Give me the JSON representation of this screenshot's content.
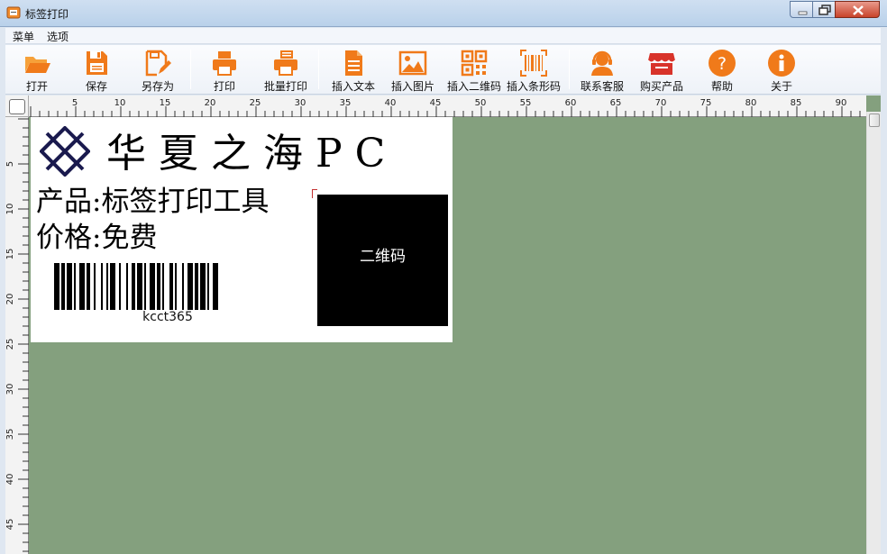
{
  "window": {
    "title": "标签打印"
  },
  "menu": {
    "items": [
      "菜单",
      "选项"
    ]
  },
  "toolbar": {
    "buttons": [
      {
        "label": "打开",
        "icon": "folder-open-icon"
      },
      {
        "label": "保存",
        "icon": "save-icon"
      },
      {
        "label": "另存为",
        "icon": "save-as-icon"
      },
      {
        "label": "打印",
        "icon": "printer-icon"
      },
      {
        "label": "批量打印",
        "icon": "batch-print-icon"
      },
      {
        "label": "插入文本",
        "icon": "text-document-icon"
      },
      {
        "label": "插入图片",
        "icon": "image-icon"
      },
      {
        "label": "插入二维码",
        "icon": "qr-code-icon"
      },
      {
        "label": "插入条形码",
        "icon": "barcode-icon"
      },
      {
        "label": "联系客服",
        "icon": "customer-service-icon"
      },
      {
        "label": "购买产品",
        "icon": "shop-icon"
      },
      {
        "label": "帮助",
        "icon": "help-icon"
      },
      {
        "label": "关于",
        "icon": "info-icon"
      }
    ],
    "accent_color": "#f07a1a",
    "shop_color": "#d8332a"
  },
  "rulers": {
    "horizontal": [
      "5",
      "10",
      "15",
      "20",
      "25",
      "30",
      "35",
      "40",
      "45",
      "50",
      "55",
      "60",
      "65",
      "70",
      "75",
      "80",
      "85",
      "90"
    ],
    "vertical": [
      "5",
      "10",
      "15",
      "20",
      "25",
      "30",
      "35",
      "40",
      "45"
    ]
  },
  "label": {
    "company": "华夏之海PC",
    "product": "产品:标签打印工具",
    "price": "价格:免费",
    "barcode_text": "kcct365",
    "qr_text": "二维码"
  },
  "colors": {
    "workspace": "#84a07e",
    "label_bg": "#ffffff",
    "logo": "#1a1a4e"
  }
}
